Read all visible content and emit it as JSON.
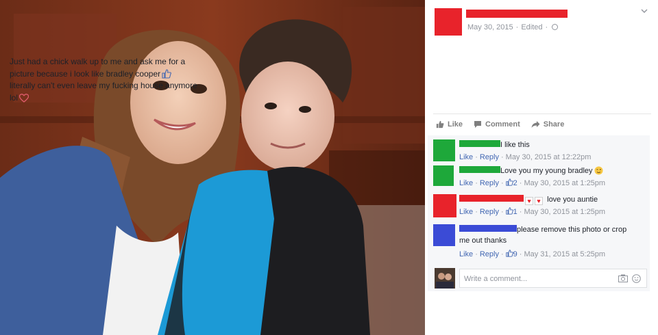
{
  "post": {
    "date": "May 30, 2015",
    "edited": "Edited",
    "text_line_1": "Just had a chick walk up to me and ask me for a",
    "text_line_2": "picture because i look like bradley cooper",
    "text_line_3": "literally can't even leave my fucking house anymore",
    "text_line_4": "lol",
    "icons": [
      "thumbs-up-icon",
      "heart-icon",
      "globe-icon",
      "chevron-down-icon"
    ],
    "redaction_color": "#e8232b"
  },
  "actions": {
    "like": "Like",
    "comment": "Comment",
    "share": "Share"
  },
  "comments": [
    {
      "text": "I like this",
      "like": "Like",
      "reply": "Reply",
      "likes": "",
      "time": "May 30, 2015 at 12:22pm",
      "color": "#1ea83a"
    },
    {
      "text": "Love you my young bradley",
      "like": "Like",
      "reply": "Reply",
      "likes": "2",
      "time": "May 30, 2015 at 1:25pm",
      "color": "#1ea83a"
    },
    {
      "text": "love you auntie",
      "like": "Like",
      "reply": "Reply",
      "likes": "1",
      "time": "May 30, 2015 at 1:25pm",
      "color": "#e8232b"
    },
    {
      "text_line_1": "please remove this photo or crop",
      "text_line_2": "me out thanks",
      "like": "Like",
      "reply": "Reply",
      "likes": "9",
      "time": "May 31, 2015 at 5:25pm",
      "color": "#3b4bd6"
    }
  ],
  "write_comment": {
    "placeholder": "Write a comment..."
  },
  "colors": {
    "link": "#4267b2",
    "meta_text": "#90949c",
    "comment_bg": "#f6f7f9"
  }
}
